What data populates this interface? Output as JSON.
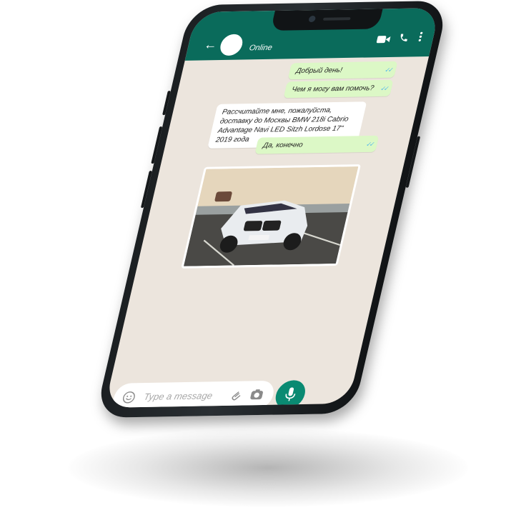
{
  "chat": {
    "contact_status": "Online",
    "messages": [
      {
        "text": "Добрый день!",
        "direction": "outgoing",
        "ticks": "✓✓"
      },
      {
        "text": "Чем я могу вам помочь?",
        "direction": "outgoing",
        "ticks": "✓✓"
      },
      {
        "text": "Рассчитайте мне, пожалуйста, доставку до Москвы BMW 218i Cabrio Advantage Navi LED Sitzh Lordose 17\"  2019 года",
        "direction": "incoming"
      },
      {
        "text": "Да, конечно",
        "direction": "outgoing",
        "ticks": "✓✓"
      }
    ],
    "image_message": {
      "description": "car-photo"
    }
  },
  "composer": {
    "placeholder": "Type a message"
  },
  "colors": {
    "header": "#0a6b5b",
    "chat_bg": "#ece5dd",
    "outgoing_bubble": "#dcf8c6",
    "incoming_bubble": "#ffffff",
    "mic_button": "#0a8a72",
    "tick_read": "#4fb6ec"
  },
  "icons": [
    "back-arrow-icon",
    "video-call-icon",
    "phone-call-icon",
    "more-vert-icon",
    "emoji-icon",
    "attach-icon",
    "camera-icon",
    "mic-icon"
  ]
}
